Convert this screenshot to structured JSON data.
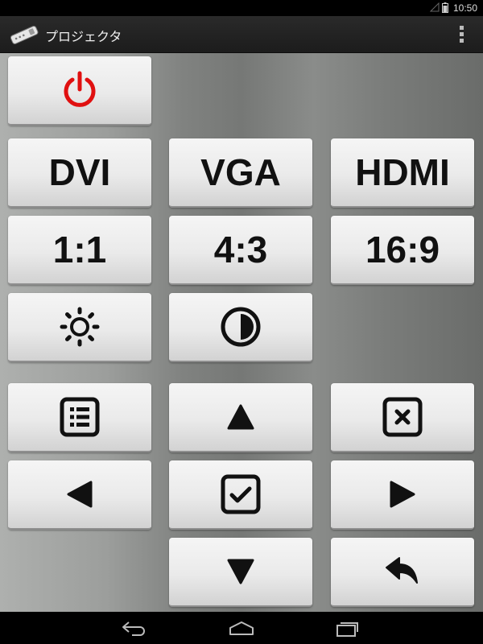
{
  "status_bar": {
    "time": "10:50"
  },
  "app": {
    "title": "プロジェクタ"
  },
  "buttons": {
    "dvi": "DVI",
    "vga": "VGA",
    "hdmi": "HDMI",
    "ratio_1_1": "1:1",
    "ratio_4_3": "4:3",
    "ratio_16_9": "16:9"
  },
  "icons": {
    "app": "remote-control-icon",
    "overflow": "overflow-menu-icon",
    "power": "power-icon",
    "brightness": "brightness-icon",
    "contrast": "contrast-icon",
    "menu": "menu-list-icon",
    "up": "arrow-up-icon",
    "close": "close-box-icon",
    "left": "arrow-left-icon",
    "enter": "checkbox-icon",
    "right": "arrow-right-icon",
    "down": "arrow-down-icon",
    "back": "return-arrow-icon",
    "nav_back": "back-icon",
    "nav_home": "home-icon",
    "nav_recents": "recents-icon"
  },
  "colors": {
    "power": "#e01010",
    "action_bar": "#222222",
    "button_text": "#111111"
  }
}
